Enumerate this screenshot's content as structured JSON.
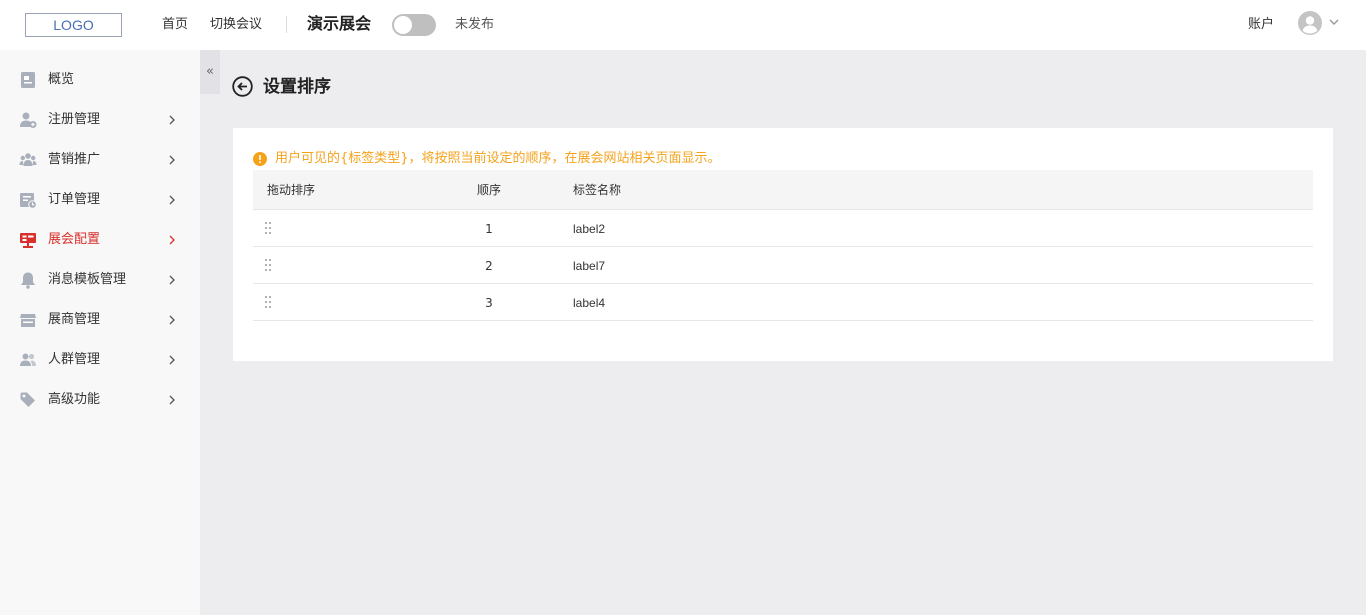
{
  "header": {
    "logo": "LOGO",
    "nav": [
      "首页",
      "切换会议"
    ],
    "expo_name": "演示展会",
    "publish_status": "未发布",
    "account": "账户"
  },
  "sidebar": {
    "collapse_glyph": "«",
    "items": [
      {
        "label": "概览",
        "icon": "overview-icon",
        "has_children": false
      },
      {
        "label": "注册管理",
        "icon": "user-add-icon",
        "has_children": true
      },
      {
        "label": "营销推广",
        "icon": "group-icon",
        "has_children": true
      },
      {
        "label": "订单管理",
        "icon": "order-icon",
        "has_children": true
      },
      {
        "label": "展会配置",
        "icon": "config-icon",
        "has_children": true,
        "active": true
      },
      {
        "label": "消息模板管理",
        "icon": "bell-icon",
        "has_children": true
      },
      {
        "label": "展商管理",
        "icon": "store-icon",
        "has_children": true
      },
      {
        "label": "人群管理",
        "icon": "people-icon",
        "has_children": true
      },
      {
        "label": "高级功能",
        "icon": "tag-icon",
        "has_children": true
      }
    ]
  },
  "page": {
    "title": "设置排序",
    "notice": "用户可见的{标签类型}，将按照当前设定的顺序，在展会网站相关页面显示。",
    "table": {
      "headers": [
        "拖动排序",
        "顺序",
        "标签名称"
      ],
      "rows": [
        {
          "order": "1",
          "name": "label2"
        },
        {
          "order": "2",
          "name": "label7"
        },
        {
          "order": "3",
          "name": "label4"
        }
      ]
    }
  },
  "colors": {
    "accent_red": "#d9302c",
    "warning": "#f5a21b",
    "background": "#ededf0",
    "sidebar_bg": "#f8f8f8"
  }
}
